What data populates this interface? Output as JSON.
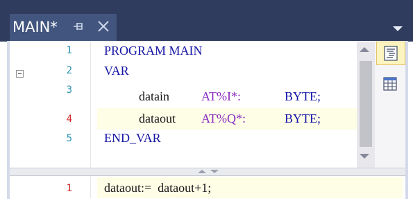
{
  "tab": {
    "title": "MAIN*"
  },
  "icons": {
    "pin": "pin-icon",
    "close": "close-icon",
    "menu": "chevron-down-icon",
    "fold": "collapse-icon",
    "text_view": "text-view-icon",
    "table_view": "table-view-icon"
  },
  "colors": {
    "tab_strip": "#2f3c5e",
    "active_tab": "#42557e",
    "line_number": "#2b91af",
    "modified_line_number": "#cf2a2a",
    "keyword": "#1414a5",
    "highlight": "#fefde6"
  },
  "declaration": {
    "line_numbers": [
      "1",
      "2",
      "3",
      "4",
      "5"
    ],
    "lines": [
      {
        "kw": "PROGRAM MAIN"
      },
      {
        "kw": "VAR"
      },
      {
        "id": "datain",
        "addr": "AT%I*:",
        "type": "BYTE;"
      },
      {
        "id": "dataout",
        "addr": "AT%Q*:",
        "type": "BYTE;"
      },
      {
        "kw": "END_VAR"
      }
    ]
  },
  "implementation": {
    "line_numbers": [
      "1"
    ],
    "code": "dataout:=  dataout+1;"
  }
}
